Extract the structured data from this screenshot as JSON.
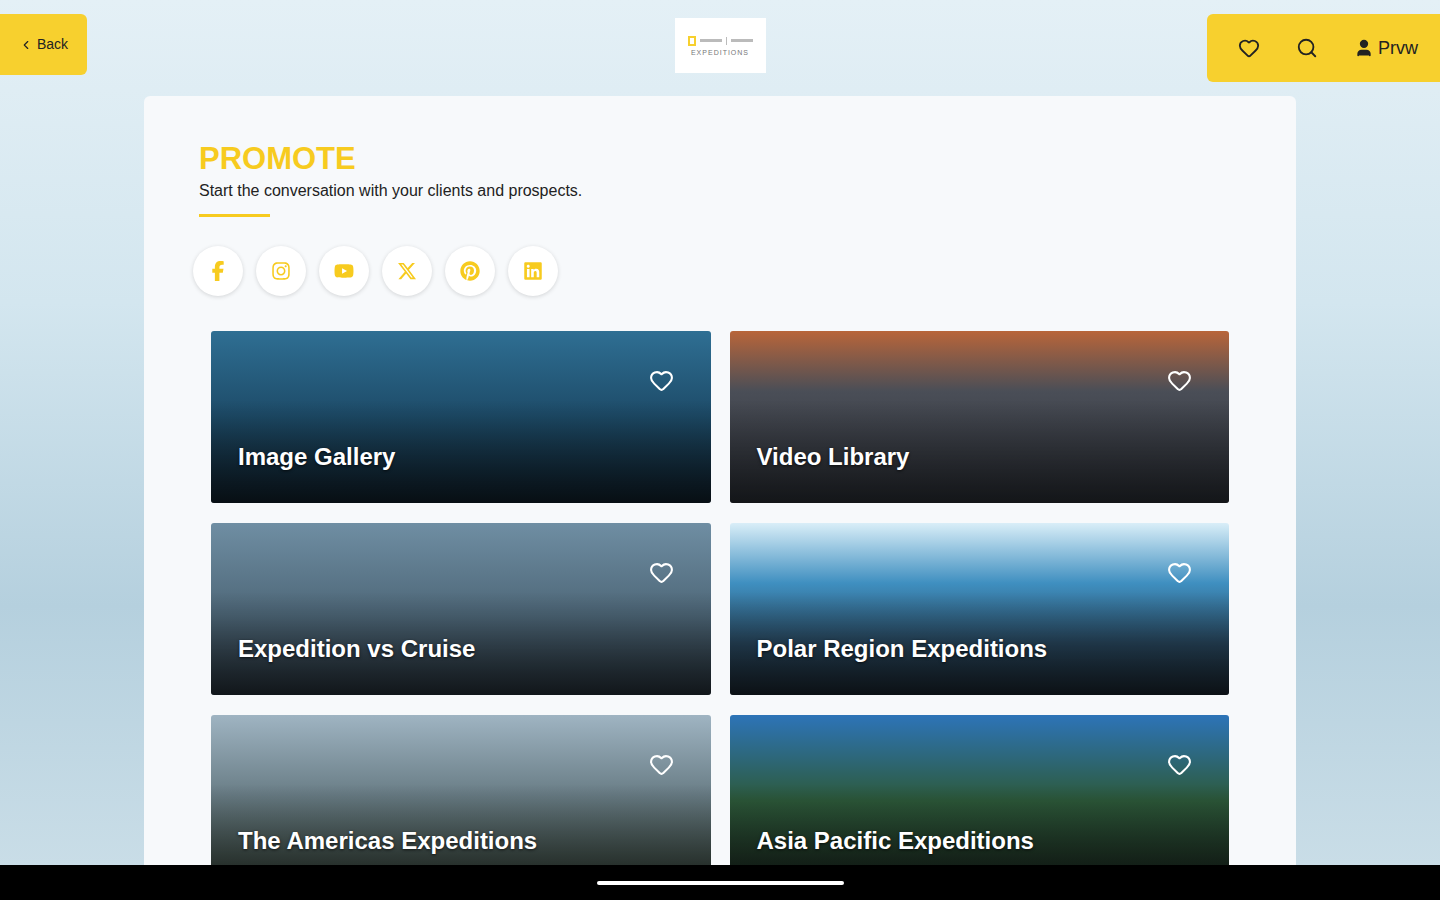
{
  "header": {
    "back": "Back",
    "logo": "EXPEDITIONS",
    "user": "Prvw"
  },
  "section": {
    "title": "PROMOTE",
    "subtitle": "Start the conversation with your clients and prospects."
  },
  "cards": [
    {
      "title": "Image Gallery",
      "favorite": false
    },
    {
      "title": "Video Library",
      "favorite": false
    },
    {
      "title": "Expedition vs Cruise",
      "favorite": false
    },
    {
      "title": "Polar Region Expeditions",
      "favorite": false
    },
    {
      "title": "The Americas Expeditions",
      "favorite": false
    },
    {
      "title": "Asia Pacific Expeditions",
      "favorite": false
    }
  ]
}
